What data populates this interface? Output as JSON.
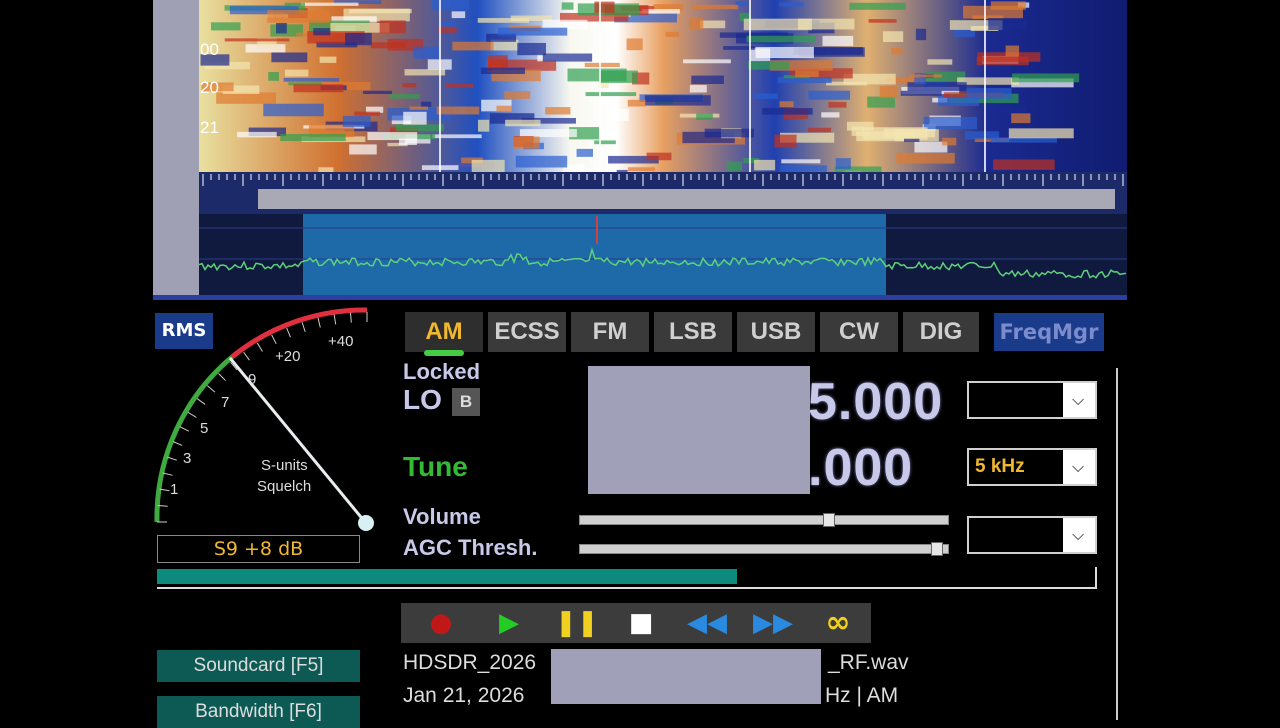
{
  "waterfall": {
    "labels": [
      "00",
      "20",
      "21"
    ]
  },
  "modes": {
    "rms_label": "RMS",
    "buttons": [
      {
        "label": "AM",
        "active": true
      },
      {
        "label": "ECSS",
        "active": false
      },
      {
        "label": "FM",
        "active": false
      },
      {
        "label": "LSB",
        "active": false
      },
      {
        "label": "USB",
        "active": false
      },
      {
        "label": "CW",
        "active": false
      },
      {
        "label": "DIG",
        "active": false
      }
    ],
    "freqmgr_label": "FreqMgr"
  },
  "smeter": {
    "scale_labels": [
      "1",
      "3",
      "5",
      "7",
      "9",
      "+20",
      "+40"
    ],
    "caption_line1": "S-units",
    "caption_line2": "Squelch",
    "readout": "S9 +8 dB"
  },
  "lo": {
    "locked_label": "Locked",
    "lo_label": "LO",
    "b_label": "B",
    "freq_visible": "5.000"
  },
  "tune": {
    "label": "Tune",
    "freq_visible": ".000",
    "step_value": "5 kHz"
  },
  "volume": {
    "label": "Volume",
    "level": 0.68
  },
  "agc": {
    "label": "AGC Thresh.",
    "level": 0.98
  },
  "progress": {
    "fraction": 0.62
  },
  "transport": {
    "buttons": [
      "record",
      "play",
      "pause",
      "stop",
      "rewind",
      "fast-forward",
      "loop"
    ]
  },
  "sidebar": {
    "soundcard_label": "Soundcard  [F5]",
    "bandwidth_label": "Bandwidth  [F6]"
  },
  "file": {
    "name_prefix": "HDSDR_2026",
    "name_suffix": "_RF.wav",
    "date_prefix": "Jan 21, 2026",
    "date_suffix": "Hz | AM"
  },
  "colors": {
    "accent_orange": "#f0b830",
    "tune_green": "#33bb33",
    "panel_blue": "#1a3a8a",
    "progress_teal": "#0d8a7e"
  }
}
